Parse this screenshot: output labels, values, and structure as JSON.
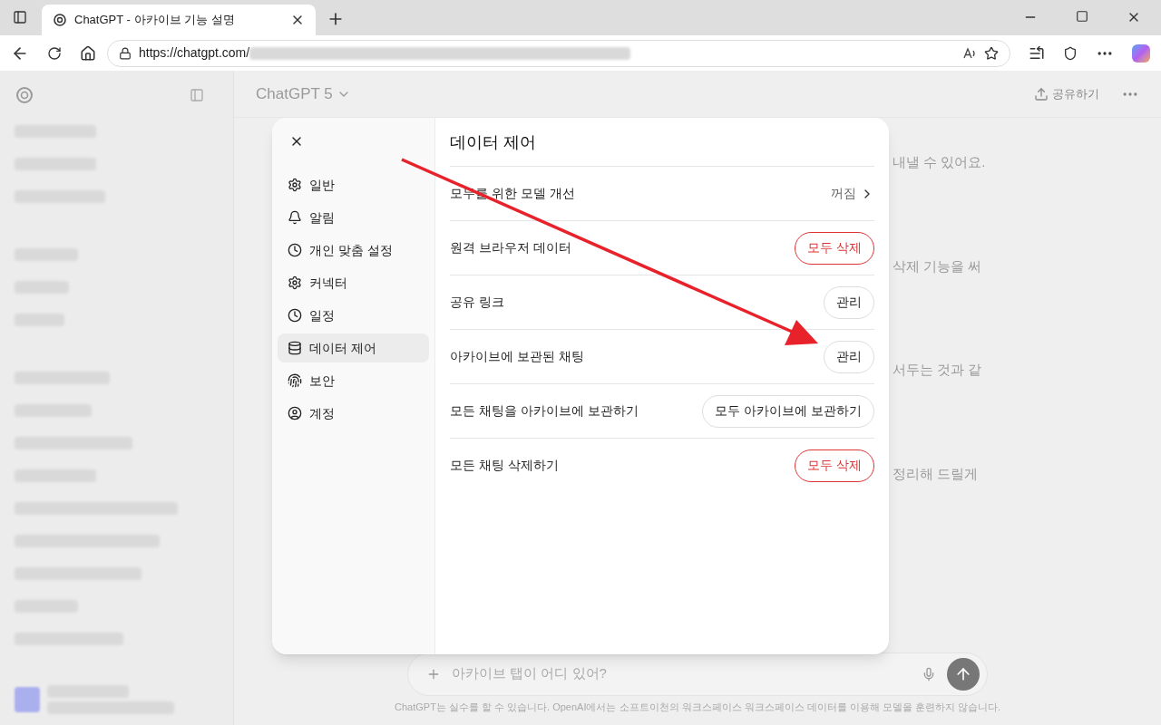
{
  "browser": {
    "tab_title": "ChatGPT - 아카이브 기능 설명",
    "url": "https://chatgpt.com/"
  },
  "header": {
    "model": "ChatGPT 5",
    "share": "공유하기"
  },
  "background_messages": [
    "내낼 수 있어요.",
    "삭제 기능을 써",
    "서두는 것과 같",
    "정리해 드릴게"
  ],
  "composer": {
    "placeholder": "아카이브 탭이 어디 있어?"
  },
  "footer_note": "ChatGPT는 실수를 할 수 있습니다. OpenAI에서는 소프트이천의 워크스페이스 워크스페이스 데이터를 이용해 모델을 훈련하지 않습니다.",
  "settings": {
    "title": "데이터 제어",
    "nav": [
      {
        "label": "일반",
        "selected": false
      },
      {
        "label": "알림",
        "selected": false
      },
      {
        "label": "개인 맞춤 설정",
        "selected": false
      },
      {
        "label": "커넥터",
        "selected": false
      },
      {
        "label": "일정",
        "selected": false
      },
      {
        "label": "데이터 제어",
        "selected": true
      },
      {
        "label": "보안",
        "selected": false
      },
      {
        "label": "계정",
        "selected": false
      }
    ],
    "rows": [
      {
        "kind": "link",
        "label": "모두를 위한 모델 개선",
        "value": "꺼짐"
      },
      {
        "kind": "button",
        "label": "원격 브라우저 데이터",
        "button": "모두 삭제",
        "danger": true
      },
      {
        "kind": "button",
        "label": "공유 링크",
        "button": "관리",
        "danger": false
      },
      {
        "kind": "button",
        "label": "아카이브에 보관된 채팅",
        "button": "관리",
        "danger": false
      },
      {
        "kind": "button",
        "label": "모든 채팅을 아카이브에 보관하기",
        "button": "모두 아카이브에 보관하기",
        "danger": false
      },
      {
        "kind": "button",
        "label": "모든 채팅 삭제하기",
        "button": "모두 삭제",
        "danger": true
      }
    ]
  }
}
